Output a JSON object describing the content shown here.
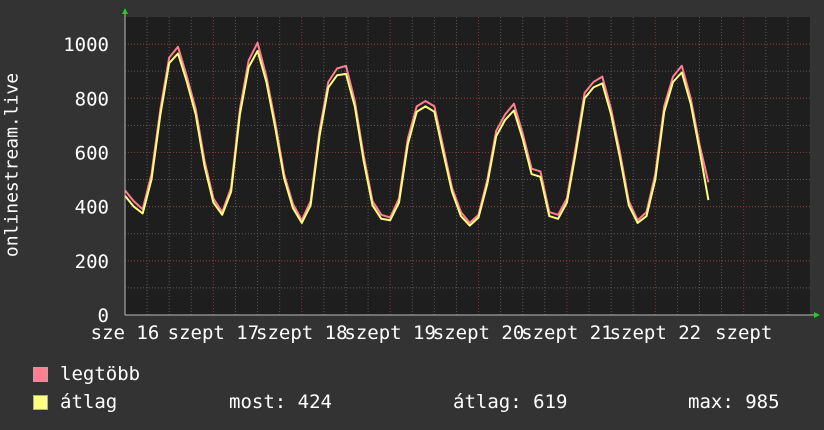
{
  "chart_data": {
    "type": "line",
    "ylabel": "onlinestream.live",
    "ylim": [
      0,
      1100
    ],
    "yticks": [
      0,
      200,
      400,
      600,
      800,
      1000
    ],
    "xlim": [
      0,
      7.75
    ],
    "xticks": [
      {
        "x": 0,
        "label": "sze 16"
      },
      {
        "x": 1,
        "label": "szept 17"
      },
      {
        "x": 2,
        "label": "szept 18"
      },
      {
        "x": 3,
        "label": "szept 19"
      },
      {
        "x": 4,
        "label": "szept 20"
      },
      {
        "x": 5,
        "label": "szept 21"
      },
      {
        "x": 6,
        "label": "szept 22"
      },
      {
        "x": 7,
        "label": "szept"
      }
    ],
    "grid": true,
    "series": [
      {
        "name": "legtöbb",
        "color": "#ff7f8f",
        "points": [
          [
            0.0,
            460
          ],
          [
            0.1,
            420
          ],
          [
            0.2,
            390
          ],
          [
            0.3,
            520
          ],
          [
            0.4,
            760
          ],
          [
            0.5,
            950
          ],
          [
            0.6,
            990
          ],
          [
            0.7,
            880
          ],
          [
            0.8,
            760
          ],
          [
            0.9,
            570
          ],
          [
            1.0,
            430
          ],
          [
            1.1,
            380
          ],
          [
            1.2,
            470
          ],
          [
            1.3,
            760
          ],
          [
            1.4,
            940
          ],
          [
            1.5,
            1005
          ],
          [
            1.6,
            880
          ],
          [
            1.7,
            710
          ],
          [
            1.8,
            520
          ],
          [
            1.9,
            410
          ],
          [
            2.0,
            350
          ],
          [
            2.1,
            420
          ],
          [
            2.2,
            680
          ],
          [
            2.3,
            860
          ],
          [
            2.4,
            910
          ],
          [
            2.5,
            920
          ],
          [
            2.6,
            790
          ],
          [
            2.7,
            590
          ],
          [
            2.8,
            420
          ],
          [
            2.9,
            370
          ],
          [
            3.0,
            360
          ],
          [
            3.1,
            430
          ],
          [
            3.2,
            650
          ],
          [
            3.3,
            770
          ],
          [
            3.4,
            790
          ],
          [
            3.5,
            770
          ],
          [
            3.6,
            620
          ],
          [
            3.7,
            470
          ],
          [
            3.8,
            380
          ],
          [
            3.9,
            340
          ],
          [
            4.0,
            370
          ],
          [
            4.1,
            500
          ],
          [
            4.2,
            680
          ],
          [
            4.3,
            740
          ],
          [
            4.4,
            780
          ],
          [
            4.5,
            670
          ],
          [
            4.6,
            540
          ],
          [
            4.7,
            530
          ],
          [
            4.8,
            380
          ],
          [
            4.9,
            370
          ],
          [
            5.0,
            430
          ],
          [
            5.1,
            620
          ],
          [
            5.2,
            820
          ],
          [
            5.3,
            860
          ],
          [
            5.4,
            880
          ],
          [
            5.5,
            760
          ],
          [
            5.6,
            600
          ],
          [
            5.7,
            420
          ],
          [
            5.8,
            350
          ],
          [
            5.9,
            380
          ],
          [
            6.0,
            520
          ],
          [
            6.1,
            770
          ],
          [
            6.2,
            880
          ],
          [
            6.3,
            920
          ],
          [
            6.4,
            800
          ],
          [
            6.5,
            630
          ],
          [
            6.6,
            490
          ]
        ]
      },
      {
        "name": "átlag",
        "color": "#ffff7f",
        "points": [
          [
            0.0,
            440
          ],
          [
            0.1,
            400
          ],
          [
            0.2,
            375
          ],
          [
            0.3,
            500
          ],
          [
            0.4,
            740
          ],
          [
            0.5,
            930
          ],
          [
            0.6,
            965
          ],
          [
            0.7,
            860
          ],
          [
            0.8,
            740
          ],
          [
            0.9,
            550
          ],
          [
            1.0,
            415
          ],
          [
            1.1,
            370
          ],
          [
            1.2,
            455
          ],
          [
            1.3,
            740
          ],
          [
            1.4,
            915
          ],
          [
            1.5,
            975
          ],
          [
            1.6,
            860
          ],
          [
            1.7,
            690
          ],
          [
            1.8,
            505
          ],
          [
            1.9,
            395
          ],
          [
            2.0,
            340
          ],
          [
            2.1,
            405
          ],
          [
            2.2,
            660
          ],
          [
            2.3,
            840
          ],
          [
            2.4,
            885
          ],
          [
            2.5,
            890
          ],
          [
            2.6,
            770
          ],
          [
            2.7,
            570
          ],
          [
            2.8,
            405
          ],
          [
            2.9,
            355
          ],
          [
            3.0,
            350
          ],
          [
            3.1,
            415
          ],
          [
            3.2,
            630
          ],
          [
            3.3,
            750
          ],
          [
            3.4,
            770
          ],
          [
            3.5,
            750
          ],
          [
            3.6,
            600
          ],
          [
            3.7,
            455
          ],
          [
            3.8,
            365
          ],
          [
            3.9,
            330
          ],
          [
            4.0,
            360
          ],
          [
            4.1,
            485
          ],
          [
            4.2,
            660
          ],
          [
            4.3,
            720
          ],
          [
            4.4,
            755
          ],
          [
            4.5,
            650
          ],
          [
            4.6,
            520
          ],
          [
            4.7,
            510
          ],
          [
            4.8,
            365
          ],
          [
            4.9,
            355
          ],
          [
            5.0,
            415
          ],
          [
            5.1,
            600
          ],
          [
            5.2,
            800
          ],
          [
            5.3,
            840
          ],
          [
            5.4,
            855
          ],
          [
            5.5,
            740
          ],
          [
            5.6,
            580
          ],
          [
            5.7,
            405
          ],
          [
            5.8,
            340
          ],
          [
            5.9,
            365
          ],
          [
            6.0,
            500
          ],
          [
            6.1,
            750
          ],
          [
            6.2,
            860
          ],
          [
            6.3,
            895
          ],
          [
            6.4,
            780
          ],
          [
            6.5,
            610
          ],
          [
            6.6,
            424
          ]
        ]
      }
    ]
  },
  "legend": [
    {
      "label": "legtöbb",
      "color": "#ff7f8f"
    },
    {
      "label": "átlag",
      "color": "#ffff7f"
    }
  ],
  "stats": {
    "current": "most: 424",
    "average": "átlag: 619",
    "max": "max: 985"
  }
}
